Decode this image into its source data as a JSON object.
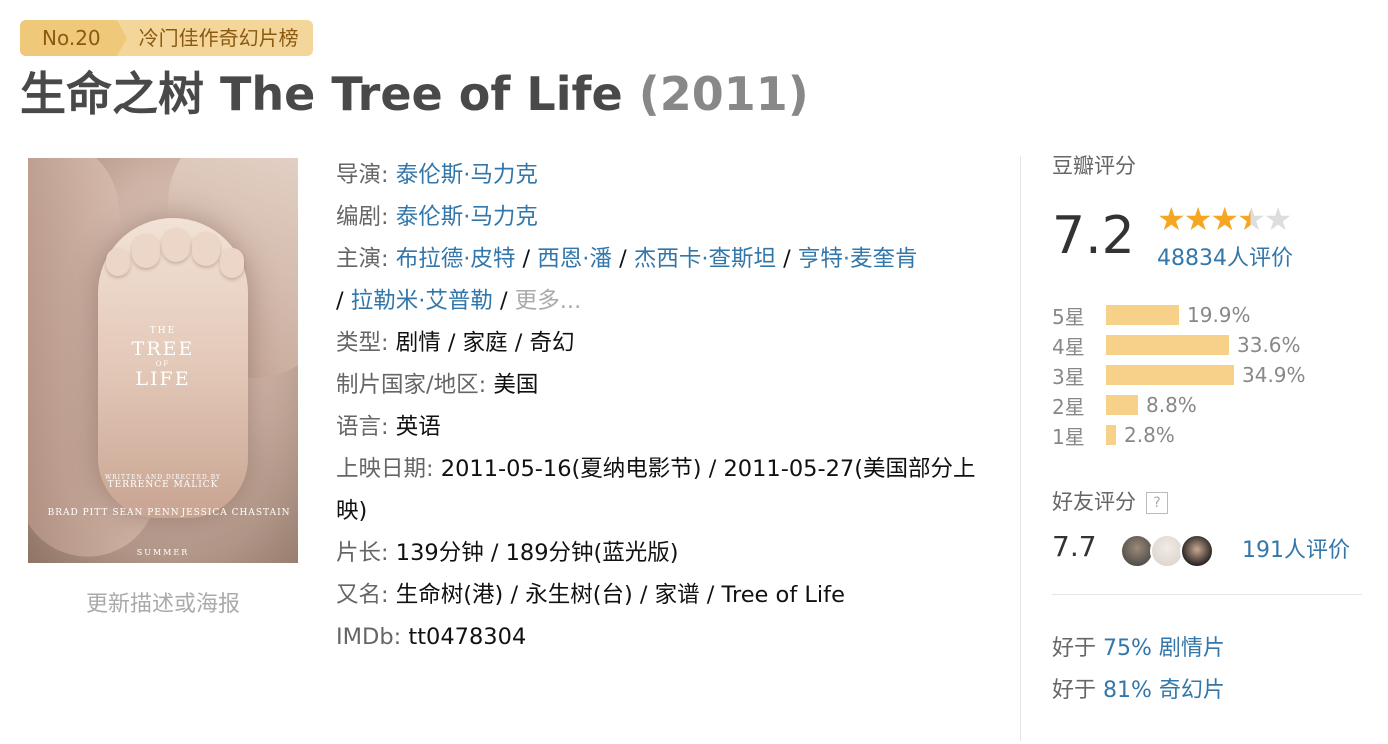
{
  "rank": {
    "no": "No.20",
    "list_name": "冷门佳作奇幻片榜"
  },
  "title": {
    "main": "生命之树 The Tree of Life",
    "year": "(2011)"
  },
  "poster": {
    "alt": "The Tree of Life poster",
    "the": "THE",
    "tree": "TREE",
    "of": "OF",
    "life": "LIFE",
    "written": "WRITTEN AND DIRECTED BY",
    "director": "TERRENCE MALICK",
    "cast": [
      "BRAD PITT",
      "SEAN PENN",
      "JESSICA CHASTAIN"
    ],
    "season": "SUMMER"
  },
  "update_link": "更新描述或海报",
  "info": {
    "director_label": "导演:",
    "director": "泰伦斯·马力克",
    "writer_label": "编剧:",
    "writer": "泰伦斯·马力克",
    "cast_label": "主演:",
    "cast": [
      "布拉德·皮特",
      "西恩·潘",
      "杰西卡·查斯坦",
      "亨特·麦奎肯",
      "拉勒米·艾普勒"
    ],
    "sep": " / ",
    "more": "更多...",
    "genre_label": "类型:",
    "genre": "剧情 / 家庭 / 奇幻",
    "country_label": "制片国家/地区:",
    "country": "美国",
    "language_label": "语言:",
    "language": "英语",
    "release_label": "上映日期:",
    "release": "2011-05-16(夏纳电影节) / 2011-05-27(美国部分上映)",
    "runtime_label": "片长:",
    "runtime": "139分钟 / 189分钟(蓝光版)",
    "aka_label": "又名:",
    "aka": "生命树(港) / 永生树(台) / 家谱 / Tree of Life",
    "imdb_label": "IMDb:",
    "imdb": "tt0478304"
  },
  "rating": {
    "label": "豆瓣评分",
    "score": "7.2",
    "stars": 3.5,
    "votes": "48834人评价",
    "distribution": [
      {
        "label": "5星",
        "percent": 19.9,
        "text": "19.9%"
      },
      {
        "label": "4星",
        "percent": 33.6,
        "text": "33.6%"
      },
      {
        "label": "3星",
        "percent": 34.9,
        "text": "34.9%"
      },
      {
        "label": "2星",
        "percent": 8.8,
        "text": "8.8%"
      },
      {
        "label": "1星",
        "percent": 2.8,
        "text": "2.8%"
      }
    ],
    "friend_label": "好友评分",
    "friend_help": "?",
    "friend_score": "7.7",
    "friend_votes": "191人评价",
    "better_than": [
      {
        "prefix": "好于 ",
        "link": "75% 剧情片"
      },
      {
        "prefix": "好于 ",
        "link": "81% 奇幻片"
      }
    ]
  },
  "colors": {
    "link": "#3377aa",
    "star": "#f5a623",
    "bar": "#f7d08a",
    "badge": "#f4d69a"
  }
}
